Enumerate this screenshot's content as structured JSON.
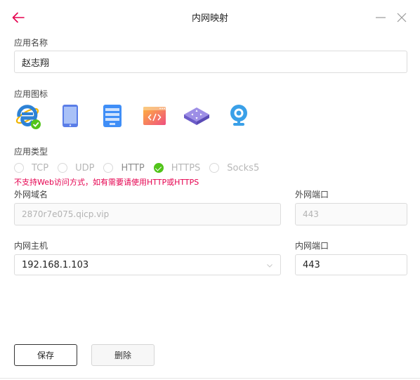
{
  "header": {
    "title": "内网映射"
  },
  "app_name": {
    "label": "应用名称",
    "value": "赵志翔"
  },
  "app_icon": {
    "label": "应用图标",
    "icons": [
      "ie-icon",
      "tablet-icon",
      "server-icon",
      "code-window-icon",
      "router-icon",
      "webcam-icon"
    ],
    "selected": "ie-icon"
  },
  "app_type": {
    "label": "应用类型",
    "options": [
      "TCP",
      "UDP",
      "HTTP",
      "HTTPS",
      "Socks5"
    ],
    "selected": "HTTPS",
    "warning": "不支持Web访问方式，如有需要请使用HTTP或HTTPS"
  },
  "external": {
    "domain_label": "外网域名",
    "domain_placeholder": "2870r7e075.qicp.vip",
    "port_label": "外网端口",
    "port_placeholder": "443"
  },
  "internal": {
    "host_label": "内网主机",
    "host_value": "192.168.1.103",
    "port_label": "内网端口",
    "port_value": "443"
  },
  "buttons": {
    "save": "保存",
    "delete": "删除"
  },
  "colors": {
    "accent": "#e5004f",
    "check": "#52c41a"
  }
}
